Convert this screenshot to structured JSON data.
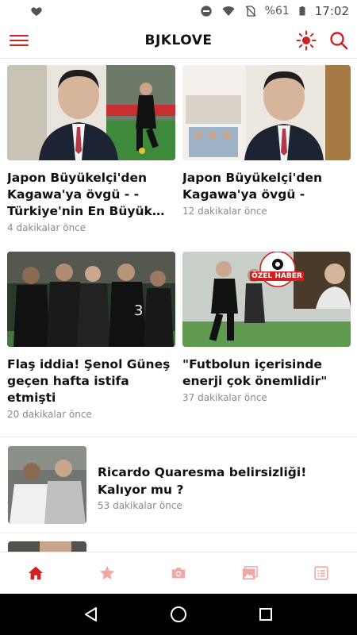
{
  "status_bar": {
    "battery_percent": "%61",
    "time": "17:02",
    "icons": [
      "heart-icon",
      "do-not-disturb-icon",
      "wifi-icon",
      "no-sim-icon",
      "battery-icon"
    ]
  },
  "app_bar": {
    "title": "BJKLOVE",
    "icons": [
      "menu-icon",
      "brightness-icon",
      "search-icon"
    ],
    "accent_color": "#d21f1f"
  },
  "feed": {
    "cards": [
      {
        "title": "Japon Büyükelçi'den Kagawa'ya övgü - - Türkiye'nin En Büyük Spor Sitesi",
        "time": "4 dakikalar önce"
      },
      {
        "title": "Japon Büyükelçi'den Kagawa'ya övgü -",
        "time": "12 dakikalar önce"
      },
      {
        "title": "Flaş iddia! Şenol Güneş geçen hafta istifa etmişti",
        "time": "20 dakikalar önce"
      },
      {
        "title": "\"Futbolun içerisinde enerji çok önemlidir\"",
        "time": "37 dakikalar önce",
        "badge": "ÖZEL HABER"
      }
    ],
    "list_items": [
      {
        "title": "Ricardo Quaresma belirsizliği! Kalıyor mu ?",
        "time": "53 dakikalar önce"
      }
    ]
  },
  "bottom_nav": {
    "items": [
      {
        "icon": "home-icon",
        "active": true
      },
      {
        "icon": "star-icon",
        "active": false
      },
      {
        "icon": "camera-icon",
        "active": false
      },
      {
        "icon": "gallery-icon",
        "active": false
      },
      {
        "icon": "list-icon",
        "active": false
      }
    ],
    "active_color": "#d21f1f",
    "inactive_color": "#f2a7a7"
  },
  "system_nav": {
    "icons": [
      "back-icon",
      "home-circle-icon",
      "recents-icon"
    ]
  }
}
